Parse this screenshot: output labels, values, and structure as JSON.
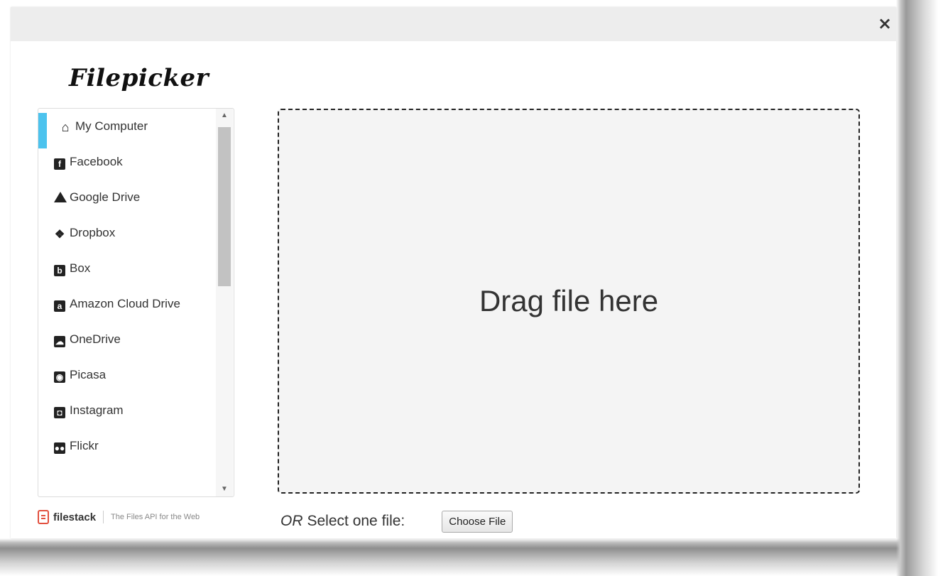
{
  "modal": {
    "close_icon": "×"
  },
  "logo": {
    "text": "Filepicker"
  },
  "sidebar": {
    "items": [
      {
        "label": "My Computer",
        "icon": "home-icon",
        "glyph": "⌂"
      },
      {
        "label": "Facebook",
        "icon": "facebook-icon",
        "glyph": "f"
      },
      {
        "label": "Google Drive",
        "icon": "google-drive-icon",
        "glyph": ""
      },
      {
        "label": "Dropbox",
        "icon": "dropbox-icon",
        "glyph": "❖"
      },
      {
        "label": "Box",
        "icon": "box-icon",
        "glyph": "b"
      },
      {
        "label": "Amazon Cloud Drive",
        "icon": "amazon-cloud-drive-icon",
        "glyph": "a"
      },
      {
        "label": "OneDrive",
        "icon": "onedrive-icon",
        "glyph": "☁"
      },
      {
        "label": "Picasa",
        "icon": "picasa-icon",
        "glyph": "◉"
      },
      {
        "label": "Instagram",
        "icon": "instagram-icon",
        "glyph": "◘"
      },
      {
        "label": "Flickr",
        "icon": "flickr-icon",
        "glyph": "●●"
      }
    ],
    "scroll_up": "▲",
    "scroll_down": "▼"
  },
  "brand": {
    "name": "filestack",
    "tagline": "The Files API for the Web"
  },
  "dropzone": {
    "text": "Drag file here"
  },
  "select": {
    "or": "OR",
    "label": "Select one file:",
    "button": "Choose File"
  },
  "colors": {
    "accent": "#4cc3ee",
    "brand": "#e2503f"
  }
}
